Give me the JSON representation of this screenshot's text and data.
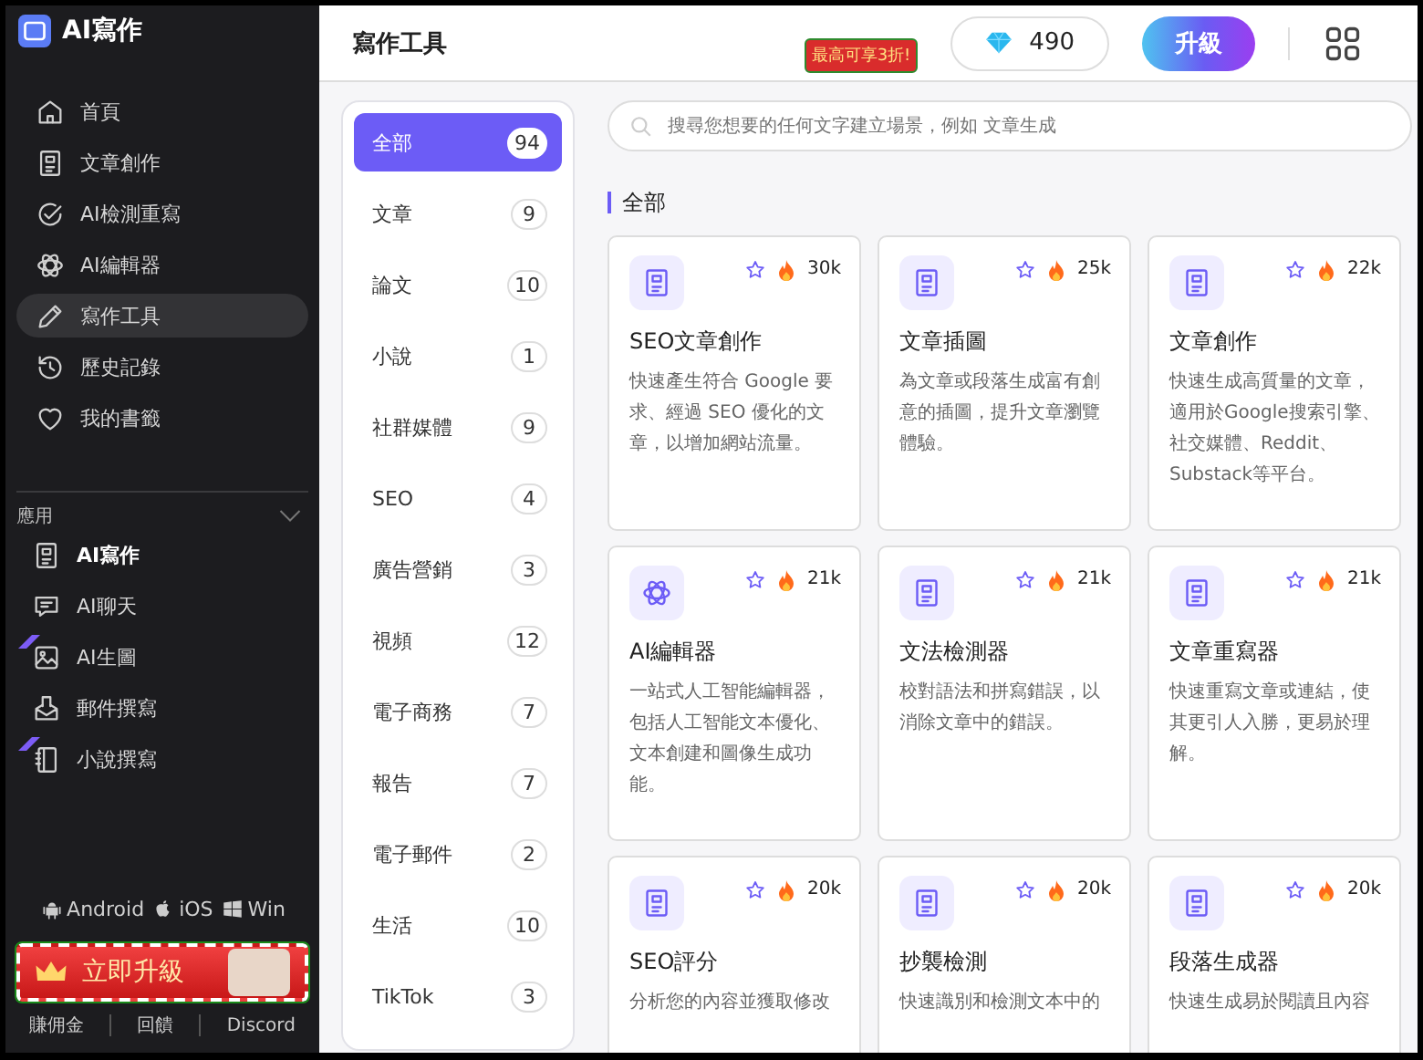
{
  "brand": {
    "name": "AI寫作"
  },
  "nav": [
    {
      "kind": "home",
      "label": "首頁",
      "selected": false
    },
    {
      "kind": "doc",
      "label": "文章創作",
      "selected": false
    },
    {
      "kind": "check",
      "label": "AI檢測重寫",
      "selected": false
    },
    {
      "kind": "atom",
      "label": "AI編輯器",
      "selected": false
    },
    {
      "kind": "pencil",
      "label": "寫作工具",
      "selected": true
    },
    {
      "kind": "history",
      "label": "歷史記錄",
      "selected": false
    },
    {
      "kind": "heart",
      "label": "我的書籤",
      "selected": false
    }
  ],
  "apps": {
    "title": "應用",
    "expanded": true,
    "items": [
      {
        "kind": "doc",
        "label": "AI寫作",
        "selected": true,
        "ribbon": false
      },
      {
        "kind": "chat",
        "label": "AI聊天",
        "selected": false,
        "ribbon": false
      },
      {
        "kind": "image",
        "label": "AI生圖",
        "selected": false,
        "ribbon": true
      },
      {
        "kind": "mail",
        "label": "郵件撰寫",
        "selected": false,
        "ribbon": false
      },
      {
        "kind": "book",
        "label": "小說撰寫",
        "selected": false,
        "ribbon": true
      }
    ]
  },
  "platforms": [
    {
      "kind": "android",
      "label": "Android"
    },
    {
      "kind": "apple",
      "label": "iOS"
    },
    {
      "kind": "windows",
      "label": "Win"
    }
  ],
  "upgrade_banner": {
    "label": "立即升級"
  },
  "footer_links": [
    "賺佣金",
    "回饋",
    "Discord"
  ],
  "header": {
    "title": "寫作工具",
    "promo": "最高可享3折!",
    "credits": "490",
    "upgrade": "升級"
  },
  "categories": [
    {
      "label": "全部",
      "count": "94",
      "selected": true
    },
    {
      "label": "文章",
      "count": "9",
      "selected": false
    },
    {
      "label": "論文",
      "count": "10",
      "selected": false
    },
    {
      "label": "小說",
      "count": "1",
      "selected": false
    },
    {
      "label": "社群媒體",
      "count": "9",
      "selected": false
    },
    {
      "label": "SEO",
      "count": "4",
      "selected": false
    },
    {
      "label": "廣告營銷",
      "count": "3",
      "selected": false
    },
    {
      "label": "視頻",
      "count": "12",
      "selected": false
    },
    {
      "label": "電子商務",
      "count": "7",
      "selected": false
    },
    {
      "label": "報告",
      "count": "7",
      "selected": false
    },
    {
      "label": "電子郵件",
      "count": "2",
      "selected": false
    },
    {
      "label": "生活",
      "count": "10",
      "selected": false
    },
    {
      "label": "TikTok",
      "count": "3",
      "selected": false
    }
  ],
  "search": {
    "placeholder": "搜尋您想要的任何文字建立場景，例如 文章生成"
  },
  "section_title": "全部",
  "tools": [
    {
      "kind": "doc",
      "title": "SEO文章創作",
      "uses": "30k",
      "favorite": false,
      "description": "快速產生符合 Google 要求、經過 SEO 優化的文章，以增加網站流量。"
    },
    {
      "kind": "doc",
      "title": "文章插圖",
      "uses": "25k",
      "favorite": false,
      "description": "為文章或段落生成富有創意的插圖，提升文章瀏覽體驗。"
    },
    {
      "kind": "doc",
      "title": "文章創作",
      "uses": "22k",
      "favorite": false,
      "description": "快速生成高質量的文章，適用於Google搜索引擎、社交媒體、Reddit、Substack等平台。"
    },
    {
      "kind": "atom",
      "title": "AI編輯器",
      "uses": "21k",
      "favorite": false,
      "description": "一站式人工智能編輯器，包括人工智能文本優化、文本創建和圖像生成功能。"
    },
    {
      "kind": "doc",
      "title": "文法檢測器",
      "uses": "21k",
      "favorite": false,
      "description": "校對語法和拼寫錯誤，以消除文章中的錯誤。"
    },
    {
      "kind": "doc",
      "title": "文章重寫器",
      "uses": "21k",
      "favorite": false,
      "description": "快速重寫文章或連結，使其更引人入勝，更易於理解。"
    },
    {
      "kind": "doc",
      "title": "SEO評分",
      "uses": "20k",
      "favorite": false,
      "description": "分析您的內容並獲取修改"
    },
    {
      "kind": "doc",
      "title": "抄襲檢測",
      "uses": "20k",
      "favorite": false,
      "description": "快速識別和檢測文本中的"
    },
    {
      "kind": "doc",
      "title": "段落生成器",
      "uses": "20k",
      "favorite": false,
      "description": "快速生成易於閱讀且內容"
    }
  ]
}
